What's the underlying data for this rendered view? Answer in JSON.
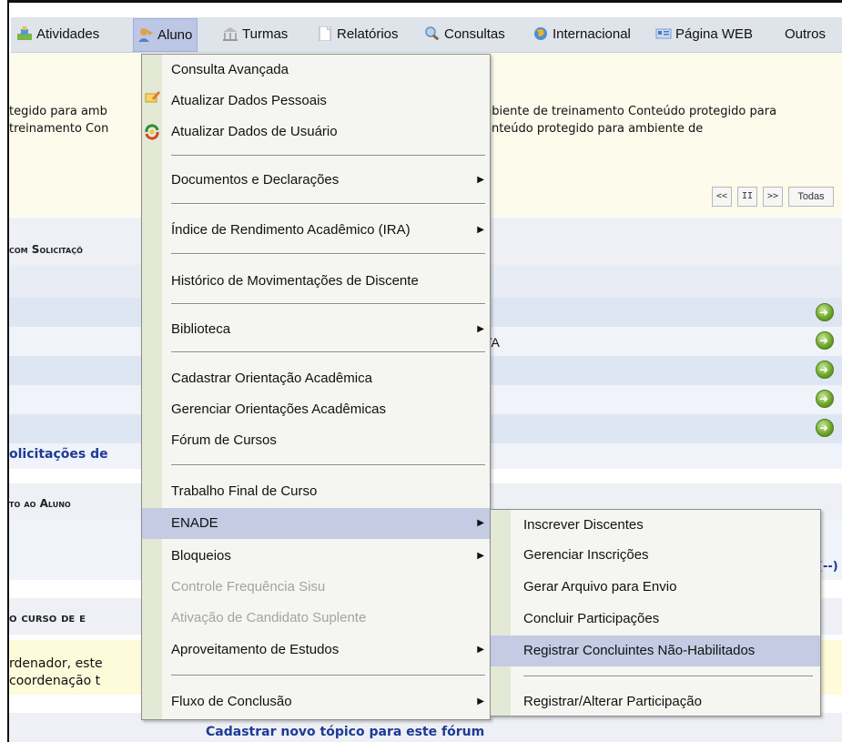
{
  "menubar": {
    "items": [
      {
        "label": "Atividades",
        "icon": "activities-icon"
      },
      {
        "label": "Aluno",
        "icon": "student-icon"
      },
      {
        "label": "Turmas",
        "icon": "classes-icon"
      },
      {
        "label": "Relatórios",
        "icon": "reports-icon"
      },
      {
        "label": "Consultas",
        "icon": "search-icon"
      },
      {
        "label": "Internacional",
        "icon": "globe-icon"
      },
      {
        "label": "Página WEB",
        "icon": "web-page-icon"
      },
      {
        "label": "Outros",
        "icon": ""
      }
    ]
  },
  "background": {
    "notice_left_1": "tegido para amb",
    "notice_left_2": "treinamento Con",
    "notice_right_1": "nbiente de treinamento Conteúdo protegido para",
    "notice_right_2": "onteúdo protegido para ambiente de",
    "pager": {
      "first": "<<",
      "pause": "II",
      "next": ">>",
      "all": "Todas"
    },
    "section_solicitacoes": "com Solicitaçõ",
    "row_text_ta": "TA",
    "link_solicitacoes": "olicitações de",
    "section_aluno": "to ao Aluno",
    "link_more": "(--)",
    "section_curso": "o curso de e",
    "forum_text_1": "rdenador, este",
    "forum_text_2": "coordenação t",
    "link_novo_topico": "Cadastrar novo tópico para este fórum"
  },
  "dropdown": {
    "items": [
      {
        "label": "Consulta Avançada"
      },
      {
        "label": "Atualizar Dados Pessoais",
        "icon": "edit-personal-icon"
      },
      {
        "label": "Atualizar Dados de Usuário",
        "icon": "user-update-icon"
      },
      {
        "label": "Documentos e Declarações",
        "submenu": true
      },
      {
        "label": "Índice de Rendimento Acadêmico (IRA)",
        "submenu": true
      },
      {
        "label": "Histórico de Movimentações de Discente"
      },
      {
        "label": "Biblioteca",
        "submenu": true
      },
      {
        "label": "Cadastrar Orientação Acadêmica"
      },
      {
        "label": "Gerenciar Orientações Acadêmicas"
      },
      {
        "label": "Fórum de Cursos"
      },
      {
        "label": "Trabalho Final de Curso"
      },
      {
        "label": "ENADE",
        "submenu": true
      },
      {
        "label": "Bloqueios",
        "submenu": true
      },
      {
        "label": "Controle Frequência Sisu"
      },
      {
        "label": "Ativação de Candidato Suplente"
      },
      {
        "label": "Aproveitamento de Estudos",
        "submenu": true
      },
      {
        "label": "Fluxo de Conclusão",
        "submenu": true
      }
    ]
  },
  "submenu": {
    "items": [
      {
        "label": "Inscrever Discentes"
      },
      {
        "label": "Gerenciar Inscrições"
      },
      {
        "label": "Gerar Arquivo para Envio"
      },
      {
        "label": "Concluir Participações"
      },
      {
        "label": "Registrar Concluintes Não-Habilitados"
      },
      {
        "label": "Registrar/Alterar Participação"
      }
    ]
  },
  "colors": {
    "menubar_bg": "#dfe3ea",
    "highlight": "#c4cbe3",
    "link_blue": "#1d3b95",
    "notice_bg": "#fdfbeb"
  }
}
